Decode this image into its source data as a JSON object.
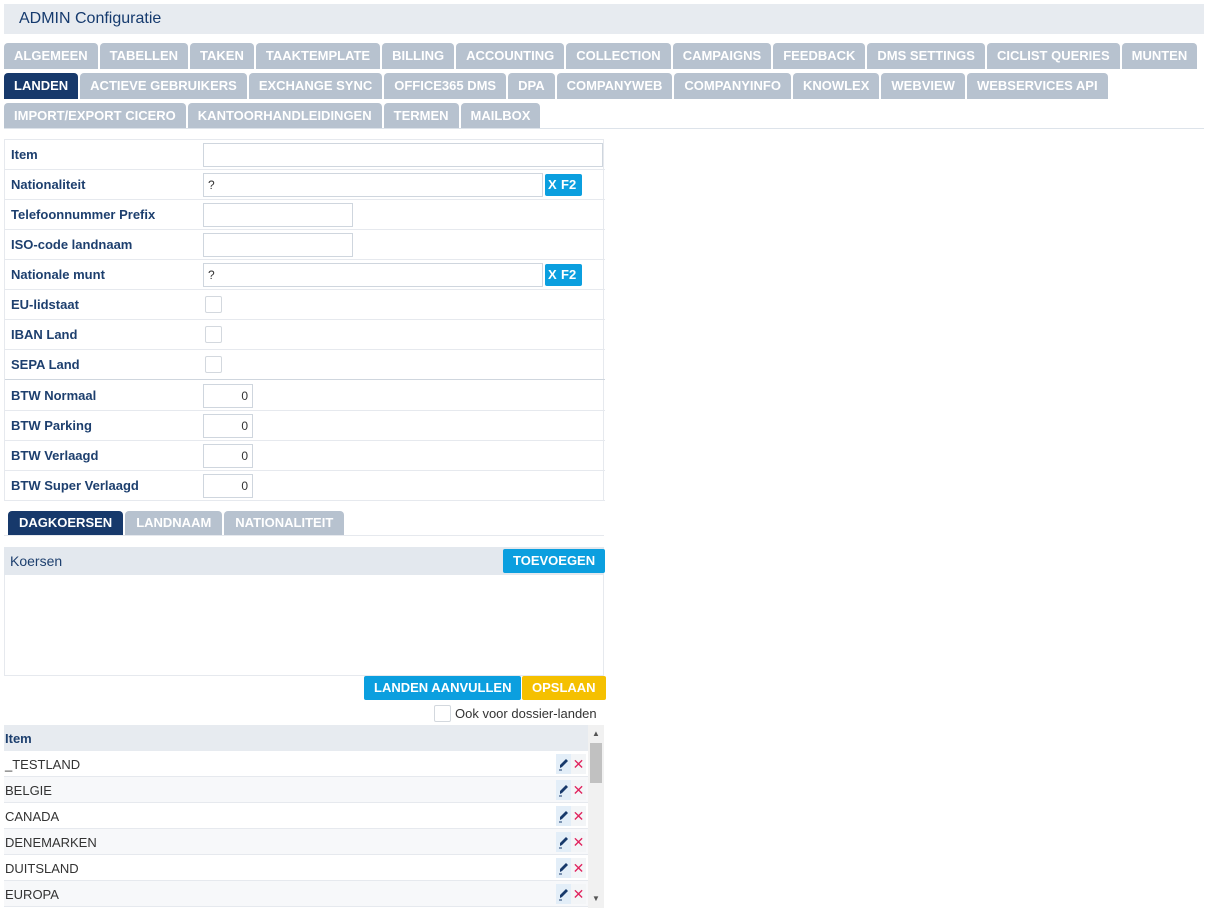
{
  "title": "ADMIN  Configuratie",
  "tabs_row1": [
    "ALGEMEEN",
    "TABELLEN",
    "TAKEN",
    "TAAKTEMPLATE",
    "BILLING",
    "ACCOUNTING",
    "COLLECTION",
    "CAMPAIGNS",
    "FEEDBACK",
    "DMS SETTINGS",
    "CICLIST QUERIES",
    "MUNTEN"
  ],
  "tabs_row2": [
    "LANDEN",
    "ACTIEVE GEBRUIKERS",
    "EXCHANGE SYNC",
    "OFFICE365 DMS",
    "DPA",
    "COMPANYWEB",
    "COMPANYINFO",
    "KNOWLEX",
    "WEBVIEW",
    "WEBSERVICES API"
  ],
  "tabs_row3": [
    "IMPORT/EXPORT CICERO",
    "KANTOORHANDLEIDINGEN",
    "TERMEN",
    "MAILBOX"
  ],
  "active_tab": "LANDEN",
  "form": {
    "item_label": "Item",
    "item_value": "",
    "nationaliteit_label": "Nationaliteit",
    "nationaliteit_value": "?",
    "telefoon_label": "Telefoonnummer Prefix",
    "telefoon_value": "",
    "iso_label": "ISO-code landnaam",
    "iso_value": "",
    "munt_label": "Nationale munt",
    "munt_value": "?",
    "eu_label": "EU-lidstaat",
    "iban_label": "IBAN Land",
    "sepa_label": "SEPA Land",
    "btw_normaal_label": "BTW Normaal",
    "btw_normaal_value": "0",
    "btw_parking_label": "BTW Parking",
    "btw_parking_value": "0",
    "btw_verlaagd_label": "BTW Verlaagd",
    "btw_verlaagd_value": "0",
    "btw_super_label": "BTW Super Verlaagd",
    "btw_super_value": "0",
    "lookup_x": "X",
    "lookup_f2": "F2"
  },
  "subtabs": [
    "DAGKOERSEN",
    "LANDNAAM",
    "NATIONALITEIT"
  ],
  "koersen": {
    "label": "Koersen",
    "add_button": "TOEVOEGEN"
  },
  "actions": {
    "aanvullen": "LANDEN AANVULLEN",
    "opslaan": "OPSLAAN",
    "ook_label": "Ook voor dossier-landen"
  },
  "grid": {
    "header": "Item",
    "rows": [
      "_TESTLAND",
      "BELGIE",
      "CANADA",
      "DENEMARKEN",
      "DUITSLAND",
      "EUROPA"
    ],
    "delete_glyph": "✕"
  },
  "colors": {
    "accent": "#0b9fdf",
    "active_tab": "#17396b",
    "inactive_tab": "#b7c2cf",
    "save": "#f5c000",
    "delete": "#e0245e"
  }
}
